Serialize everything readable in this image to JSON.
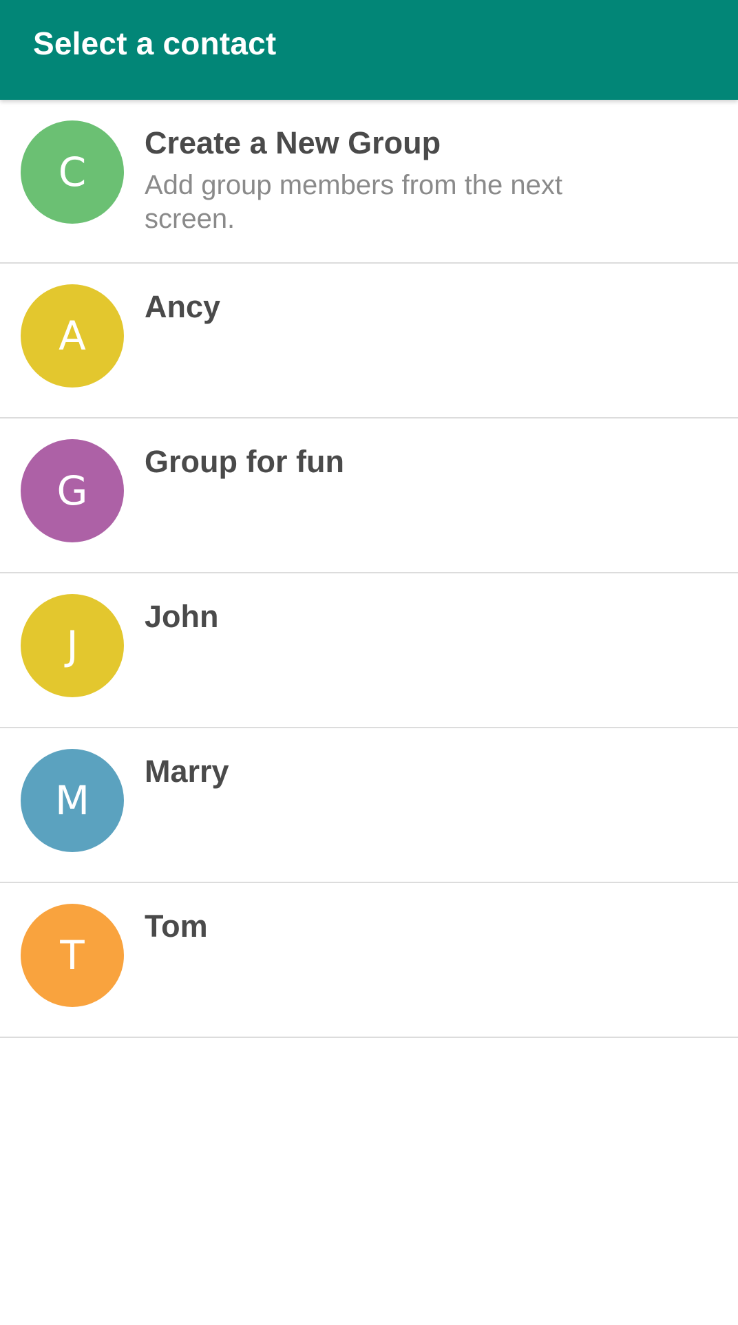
{
  "appbar": {
    "title": "Select a contact",
    "color": "#028677"
  },
  "create_group": {
    "initial": "C",
    "title": "Create a New Group",
    "subtitle": "Add group members from the next screen.",
    "avatar_color": "#6BC073"
  },
  "contacts": [
    {
      "initial": "A",
      "name": "Ancy",
      "avatar_color": "#E3C72E"
    },
    {
      "initial": "G",
      "name": "Group for fun",
      "avatar_color": "#AD61A6"
    },
    {
      "initial": "J",
      "name": "John",
      "avatar_color": "#E3C72E"
    },
    {
      "initial": "M",
      "name": "Marry",
      "avatar_color": "#5BA2BF"
    },
    {
      "initial": "T",
      "name": "Tom",
      "avatar_color": "#F9A33E"
    }
  ]
}
